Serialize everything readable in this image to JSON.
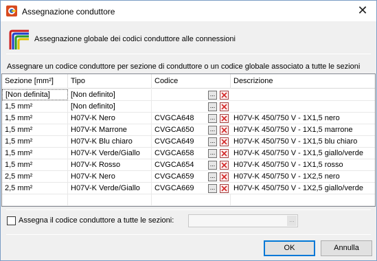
{
  "window": {
    "title": "Assegnazione conduttore",
    "close_symbol": "✕"
  },
  "header": {
    "text": "Assegnazione globale dei codici conduttore alle connessioni",
    "icon": "wire-colors-icon"
  },
  "instruction": "Assegnare un codice conduttore per sezione di conduttore o un codice globale associato a tutte le sezioni",
  "table": {
    "columns": [
      "Sezione [mm²]",
      "Tipo",
      "Codice",
      "Descrizione"
    ],
    "button_label": "...",
    "rows": [
      {
        "sezione": "[Non definita]",
        "tipo": "[Non definito]",
        "codice": "",
        "descrizione": ""
      },
      {
        "sezione": "1,5 mm²",
        "tipo": "[Non definito]",
        "codice": "",
        "descrizione": ""
      },
      {
        "sezione": "1,5 mm²",
        "tipo": "H07V-K Nero",
        "codice": "CVGCA648",
        "descrizione": "H07V-K 450/750 V - 1X1,5 nero"
      },
      {
        "sezione": "1,5 mm²",
        "tipo": "H07V-K Marrone",
        "codice": "CVGCA650",
        "descrizione": "H07V-K 450/750 V - 1X1,5 marrone"
      },
      {
        "sezione": "1,5 mm²",
        "tipo": "H07V-K Blu chiaro",
        "codice": "CVGCA649",
        "descrizione": "H07V-K 450/750 V - 1X1,5 blu chiaro"
      },
      {
        "sezione": "1,5 mm²",
        "tipo": "H07V-K Verde/Giallo",
        "codice": "CVGCA658",
        "descrizione": "H07V-K 450/750 V - 1X1,5 giallo/verde"
      },
      {
        "sezione": "1,5 mm²",
        "tipo": "H07V-K Rosso",
        "codice": "CVGCA654",
        "descrizione": "H07V-K 450/750 V - 1X1,5 rosso"
      },
      {
        "sezione": "2,5 mm²",
        "tipo": "H07V-K Nero",
        "codice": "CVGCA659",
        "descrizione": "H07V-K 450/750 V - 1X2,5 nero"
      },
      {
        "sezione": "2,5 mm²",
        "tipo": "H07V-K Verde/Giallo",
        "codice": "CVGCA669",
        "descrizione": "H07V-K 450/750 V - 1X2,5 giallo/verde"
      }
    ]
  },
  "global": {
    "checkbox_label": "Assegna il codice conduttore a tutte le sezioni:",
    "checked": false,
    "value": "",
    "button_label": "..."
  },
  "buttons": {
    "ok": "OK",
    "cancel": "Annulla"
  },
  "colors": {
    "delete_red": "#d32f2f",
    "ok_border": "#0078d7"
  }
}
